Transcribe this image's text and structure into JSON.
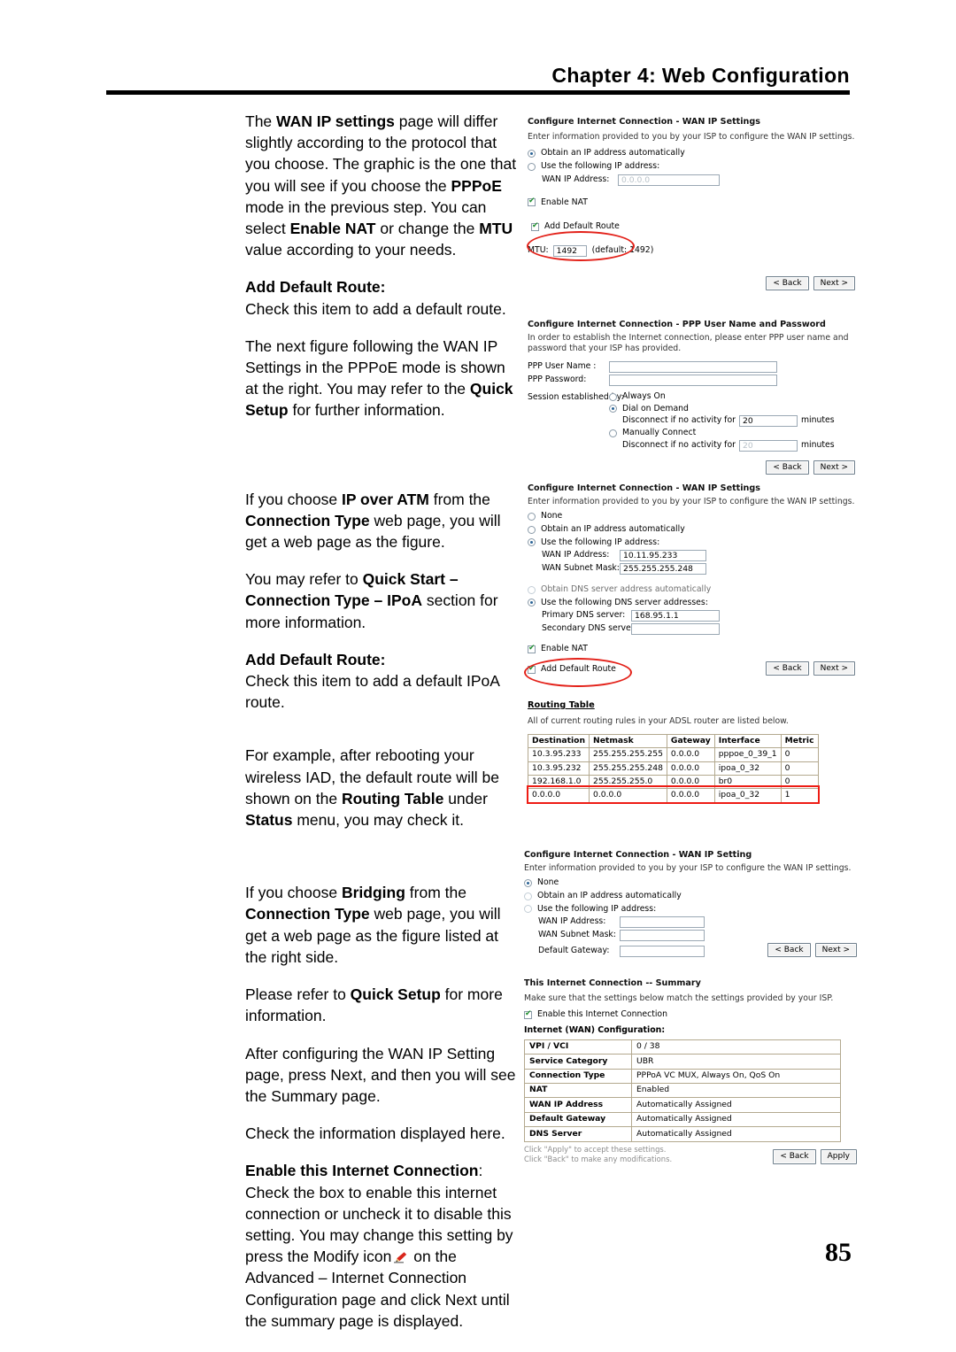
{
  "header": {
    "title": "Chapter 4: Web Configuration"
  },
  "footer": {
    "page_number": "85"
  },
  "body": {
    "p1_a": "The ",
    "p1_b1": "WAN IP settings",
    "p1_c": " page will differ slightly according to the protocol that you choose. The graphic is the one that you will see if you choose the ",
    "p1_b2": "PPPoE",
    "p1_d": " mode in the previous step. You can select ",
    "p1_b3": "Enable NAT",
    "p1_e": " or change the ",
    "p1_b4": "MTU",
    "p1_f": " value according to your needs.",
    "h1": "Add Default Route:",
    "p2": "Check this item to add a default route.",
    "p3_a": "The next figure following the WAN IP Settings in the PPPoE mode is shown at the right. You may refer to the ",
    "p3_b": "Quick Setup",
    "p3_c": " for further information.",
    "p4_a": "If you choose ",
    "p4_b1": "IP over ATM",
    "p4_c": " from the ",
    "p4_b2": "Connection Type",
    "p4_d": " web page, you will get a web page as the figure.",
    "p5_a": "You may refer to ",
    "p5_b1": "Quick Start –",
    "p5_b2": "Connection Type – IPoA",
    "p5_c": " section for more information.",
    "h2": "Add Default Route:",
    "p6": "Check this item to add a default IPoA route.",
    "p7_a": "For example, after rebooting your wireless IAD, the default route will be shown on the ",
    "p7_b1": "Routing Table",
    "p7_c": " under ",
    "p7_b2": "Status",
    "p7_d": " menu, you may check it.",
    "p8_a": "If you choose ",
    "p8_b1": "Bridging",
    "p8_c": " from the ",
    "p8_b2": "Connection Type",
    "p8_d": " web page, you will get a web page as the figure listed at the right side.",
    "p9_a": "Please refer to ",
    "p9_b": "Quick Setup",
    "p9_c": " for more information.",
    "p10": "After configuring the WAN IP Setting page, press Next, and then you will see the Summary page.",
    "p11": "Check the information displayed here.",
    "h3": "Enable this Internet Connection",
    "h3_colon": ":",
    "p12_a": "Check the box to enable this internet connection or uncheck it to disable this setting. You may change this setting by press the Modify icon",
    "p12_b": " on the Advanced – Internet Connection Configuration page and click Next until the summary page is displayed."
  },
  "fig1": {
    "title": "Configure Internet Connection - WAN IP Settings",
    "desc": "Enter information provided to you by your ISP to configure the WAN IP settings.",
    "opt_auto": "Obtain an IP address automatically",
    "opt_static": "Use the following IP address:",
    "wan_ip_label": "WAN IP Address:",
    "wan_ip_value": "0.0.0.0",
    "enable_nat": "Enable NAT",
    "add_default_route": "Add Default Route",
    "mtu_label": "MTU:",
    "mtu_value": "1492",
    "mtu_default": "(default: 1492)",
    "back": "< Back",
    "next": "Next >"
  },
  "fig2": {
    "title_a": "Configure Internet Connection",
    "title_b": " - PPP User Name and Password",
    "desc": "In order to establish the Internet connection, please enter PPP user name and password that your ISP has provided.",
    "user_label": "PPP User Name :",
    "user_value": "",
    "pass_label": "PPP Password:",
    "pass_value": "",
    "session_label": "Session established by:",
    "opt_always": "Always On",
    "opt_dial": "Dial on Demand",
    "disconnect_label": "Disconnect if no activity for",
    "dial_timeout": "20",
    "minutes": "minutes",
    "opt_manual": "Manually Connect",
    "manual_timeout": "20",
    "back": "< Back",
    "next": "Next >"
  },
  "fig3": {
    "title": "Configure Internet Connection - WAN IP Settings",
    "desc": "Enter information provided to you by your ISP to configure the WAN IP settings.",
    "opt_none": "None",
    "opt_auto": "Obtain an IP address automatically",
    "opt_static": "Use the following IP address:",
    "wan_ip_label": "WAN IP Address:",
    "wan_ip_value": "10.11.95.233",
    "wan_mask_label": "WAN Subnet Mask:",
    "wan_mask_value": "255.255.255.248",
    "dns_auto": "Obtain DNS server address automatically",
    "dns_static": "Use the following DNS server addresses:",
    "dns1_label": "Primary DNS server:",
    "dns1_value": "168.95.1.1",
    "dns2_label": "Secondary DNS server:",
    "dns2_value": "",
    "enable_nat": "Enable NAT",
    "add_default_route": "Add Default Route",
    "back": "< Back",
    "next": "Next >"
  },
  "routing": {
    "title": "Routing Table",
    "desc": "All of current routing rules in your ADSL router are listed below.",
    "columns": [
      "Destination",
      "Netmask",
      "Gateway",
      "Interface",
      "Metric"
    ],
    "rows": [
      [
        "10.3.95.233",
        "255.255.255.255",
        "0.0.0.0",
        "pppoe_0_39_1",
        "0"
      ],
      [
        "10.3.95.232",
        "255.255.255.248",
        "0.0.0.0",
        "ipoa_0_32",
        "0"
      ],
      [
        "192.168.1.0",
        "255.255.255.0",
        "0.0.0.0",
        "br0",
        "0"
      ],
      [
        "0.0.0.0",
        "0.0.0.0",
        "0.0.0.0",
        "ipoa_0_32",
        "1"
      ]
    ],
    "highlighted_row_index": 3
  },
  "fig4": {
    "title": "Configure Internet Connection - WAN IP Setting",
    "desc": "Enter information provided to you by your ISP to configure the WAN IP settings.",
    "opt_none": "None",
    "opt_auto": "Obtain an IP address automatically",
    "opt_static": "Use the following IP address:",
    "wan_ip_label": "WAN IP Address:",
    "wan_ip_value": "",
    "wan_mask_label": "WAN Subnet Mask:",
    "wan_mask_value": "",
    "gateway_label": "Default Gateway:",
    "gateway_value": "",
    "back": "< Back",
    "next": "Next >"
  },
  "summary": {
    "title_a": "This Internet Connection",
    "title_b": " -- Summary",
    "desc": "Make sure that the settings below match the settings provided by your ISP.",
    "enable_label": "Enable this Internet Connection",
    "section_head": "Internet (WAN) Configuration:",
    "rows": [
      [
        "VPI / VCI",
        "0 / 38"
      ],
      [
        "Service Category",
        "UBR"
      ],
      [
        "Connection Type",
        "PPPoA VC MUX, Always On, QoS On"
      ],
      [
        "NAT",
        "Enabled"
      ],
      [
        "WAN IP Address",
        "Automatically Assigned"
      ],
      [
        "Default Gateway",
        "Automatically Assigned"
      ],
      [
        "DNS Server",
        "Automatically Assigned"
      ]
    ],
    "note1": "Click \"Apply\" to accept these settings.",
    "note2": "Click \"Back\" to make any modifications.",
    "back": "< Back",
    "apply": "Apply"
  },
  "colors": {
    "annotation_red": "#e32119",
    "highlight_red": "#ee1c14",
    "link_blue": "#2a6496"
  }
}
